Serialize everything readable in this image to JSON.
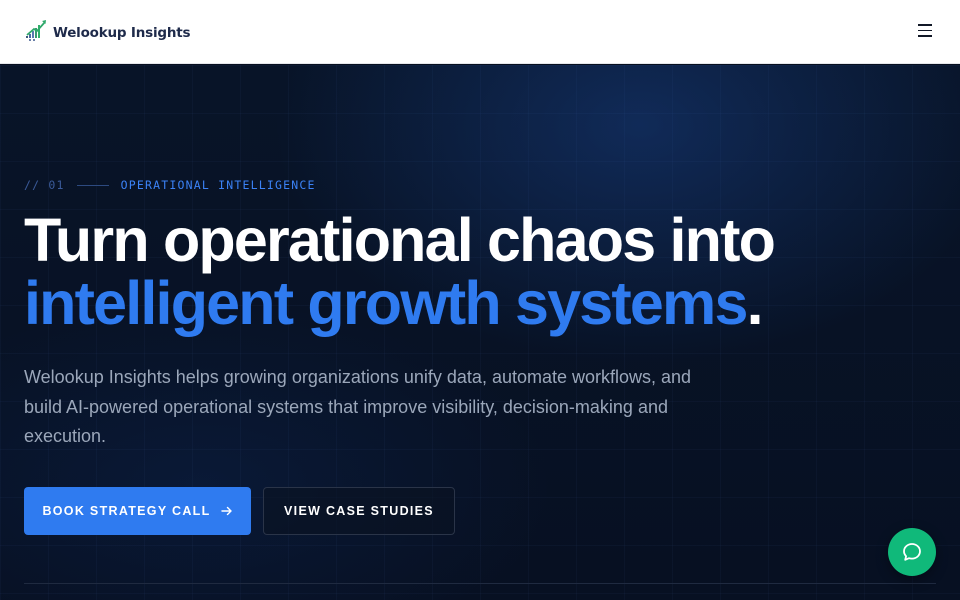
{
  "header": {
    "logo_text": "Welookup Insights",
    "menu_icon": "hamburger-menu-icon"
  },
  "hero": {
    "eyebrow": {
      "number": "// 01",
      "label": "OPERATIONAL INTELLIGENCE"
    },
    "headline": {
      "line1": "Turn operational chaos into",
      "accent": "intelligent growth systems",
      "period": "."
    },
    "description": "Welookup Insights helps growing organizations unify data, automate workflows, and build AI-powered operational systems that improve visibility, decision-making and execution.",
    "primary_cta": {
      "label": "BOOK STRATEGY CALL",
      "icon": "arrow-right-icon"
    },
    "secondary_cta": {
      "label": "VIEW CASE STUDIES"
    }
  },
  "chat": {
    "icon": "chat-bubble-icon"
  },
  "colors": {
    "accent": "#2f7bf0",
    "background": "#070f1f",
    "chat": "#10b97a",
    "header_bg": "#ffffff"
  }
}
